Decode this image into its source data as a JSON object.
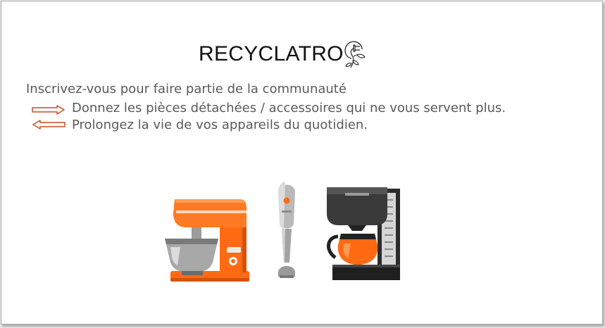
{
  "brand": {
    "title": "RECYCLATRO",
    "logo_icon": "leaf-plug-icon"
  },
  "intro": "Inscrivez-vous pour faire partie de la communauté",
  "points": [
    {
      "icon": "arrow-right-icon",
      "text": "Donnez les pièces détachées / accessoires qui ne vous servent plus."
    },
    {
      "icon": "arrow-left-icon",
      "text": "Prolongez la vie de vos appareils du quotidien."
    }
  ],
  "illustration": {
    "items": [
      "stand-mixer-icon",
      "hand-blender-icon",
      "coffee-maker-icon"
    ]
  },
  "colors": {
    "accent": "#ff6a13",
    "arrow": "#c8502a",
    "text": "#5a5a5a"
  }
}
